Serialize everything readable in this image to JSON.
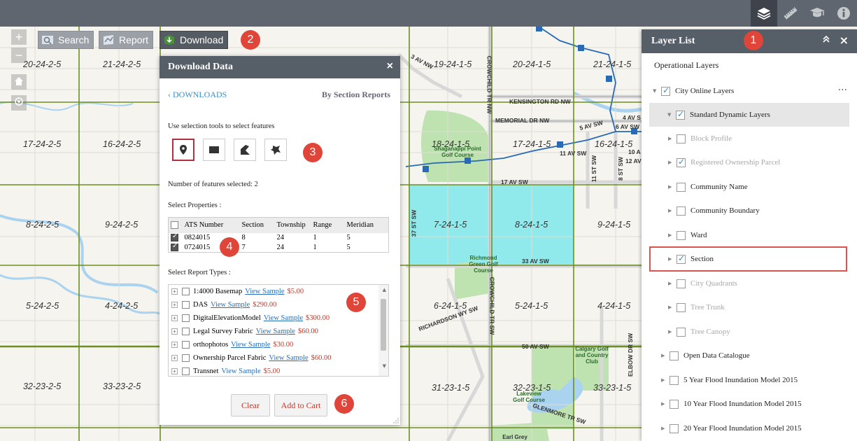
{
  "toolbar": {
    "search_label": "Search",
    "report_label": "Report",
    "download_label": "Download",
    "zoom_in": "+",
    "zoom_out": "−"
  },
  "badges": [
    "1",
    "2",
    "3",
    "4",
    "5",
    "6"
  ],
  "top_icons": [
    "layers-icon",
    "ruler-icon",
    "graduation-cap-icon",
    "info-icon"
  ],
  "map": {
    "section_labels": [
      "20-24-2-5",
      "21-24-2-5",
      "17-24-2-5",
      "16-24-2-5",
      "8-24-2-5",
      "9-24-2-5",
      "5-24-2-5",
      "4-24-2-5",
      "32-23-2-5",
      "33-23-2-5",
      "19-24-1-5",
      "20-24-1-5",
      "21-24-1-5",
      "18-24-1-5",
      "17-24-1-5",
      "16-24-1-5",
      "7-24-1-5",
      "8-24-1-5",
      "9-24-1-5",
      "6-24-1-5",
      "5-24-1-5",
      "4-24-1-5",
      "31-23-1-5",
      "32-23-1-5",
      "33-23-1-5"
    ],
    "road_labels": [
      "3 AV NW",
      "KENSINGTON RD NW",
      "MEMORIAL DR NW",
      "5 AV SW",
      "6 AV SW",
      "11 AV SW",
      "17 AV SW",
      "33 AV SW",
      "50 AV SW",
      "GLENMORE TR SW",
      "CROWCHILD TR NW",
      "CROWCHILD TR SW",
      "37 ST SW",
      "11 ST SW",
      "8 ST SW",
      "ELBOW DR SW",
      "RICHARDSON WY SW",
      "4 AV S",
      "10 A",
      "12 AV"
    ],
    "place_labels": [
      "Shaganappi Point Golf Course",
      "Richmond Green Golf Course",
      "Calgary Golf and Country Club",
      "Lakeview Golf Course",
      "Earl Grey"
    ]
  },
  "download_panel": {
    "title": "Download Data",
    "close": "×",
    "back_link": "‹ DOWNLOADS",
    "subtitle": "By Section Reports",
    "instruction": "Use selection tools to select features",
    "selection_tools": [
      "point-tool-icon",
      "rectangle-tool-icon",
      "polygon-tool-icon",
      "freehand-tool-icon"
    ],
    "features_selected": "Number of features selected: 2",
    "select_properties_label": "Select Properties :",
    "table": {
      "headers": [
        "ATS Number",
        "Section",
        "Township",
        "Range",
        "Meridian"
      ],
      "rows": [
        {
          "ats": "0824015",
          "section": "8",
          "township": "24",
          "range": "1",
          "meridian": "5"
        },
        {
          "ats": "0724015",
          "section": "7",
          "township": "24",
          "range": "1",
          "meridian": "5"
        }
      ]
    },
    "report_types_label": "Select Report Types :",
    "report_types": [
      {
        "name": "1:4000 Basemap",
        "link": "View Sample",
        "price": "$5.00"
      },
      {
        "name": "DAS",
        "link": "View Sample",
        "price": "$290.00"
      },
      {
        "name": "DigitalElevationModel",
        "link": "View Sample",
        "price": "$300.00"
      },
      {
        "name": "Legal Survey Fabric",
        "link": "View Sample",
        "price": "$60.00"
      },
      {
        "name": "orthophotos",
        "link": "View Sample",
        "price": "$30.00"
      },
      {
        "name": "Ownership Parcel Fabric",
        "link": "View Sample",
        "price": "$60.00"
      },
      {
        "name": "Transnet",
        "link": "View Sample",
        "price": "$5.00"
      }
    ],
    "clear_button": "Clear",
    "add_to_cart_button": "Add to Cart"
  },
  "layer_panel": {
    "title": "Layer List",
    "collapse": "⌃",
    "close": "×",
    "operational_layers": "Operational Layers",
    "more": "···",
    "layers": [
      {
        "label": "City Online Layers",
        "checked": true,
        "faded": false
      },
      {
        "label": "Standard Dynamic Layers",
        "checked": true,
        "faded": false
      },
      {
        "label": "Block Profile",
        "checked": false,
        "faded": true
      },
      {
        "label": "Registered Ownership Parcel",
        "checked": true,
        "faded": true
      },
      {
        "label": "Community Name",
        "checked": false,
        "faded": false
      },
      {
        "label": "Community Boundary",
        "checked": false,
        "faded": false
      },
      {
        "label": "Ward",
        "checked": false,
        "faded": false
      },
      {
        "label": "Section",
        "checked": true,
        "faded": false
      },
      {
        "label": "City Quadrants",
        "checked": false,
        "faded": true
      },
      {
        "label": "Tree Trunk",
        "checked": false,
        "faded": true
      },
      {
        "label": "Tree Canopy",
        "checked": false,
        "faded": true
      },
      {
        "label": "Open Data Catalogue",
        "checked": false,
        "faded": false
      },
      {
        "label": "5 Year Flood Inundation Model 2015",
        "checked": false,
        "faded": false
      },
      {
        "label": "10 Year Flood Inundation Model 2015",
        "checked": false,
        "faded": false
      },
      {
        "label": "20 Year Flood Inundation Model 2015",
        "checked": false,
        "faded": false
      }
    ]
  }
}
